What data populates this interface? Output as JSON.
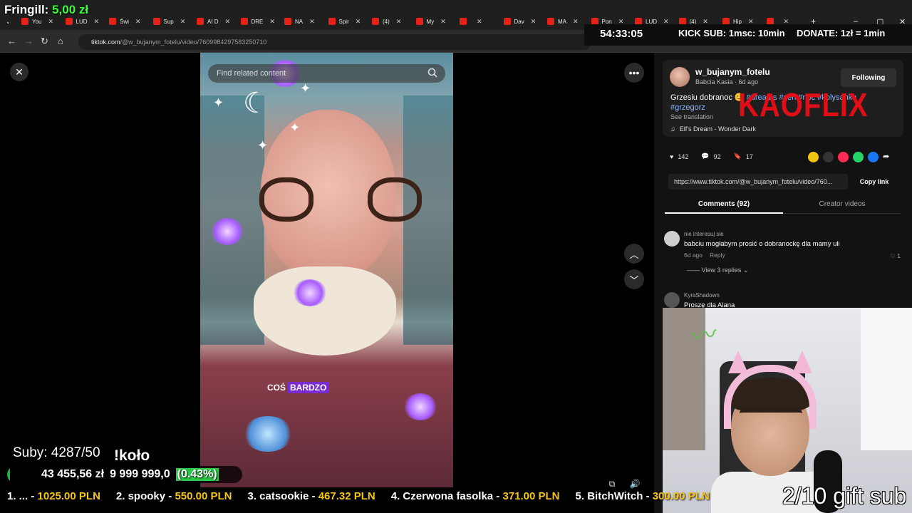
{
  "overlay": {
    "fringill_label": "Fringill:",
    "fringill_amount": "5,00 zł",
    "timer": "54:33:05",
    "kick_sub": "KICK SUB: 1msc: 10min",
    "donate": "DONATE: 1zł = 1min",
    "subs": "Suby: 4287/50",
    "kolo": "!koło",
    "goal_current": "43 455,56 zł",
    "goal_target": "9 999 999,0",
    "goal_percent": "(0.43%)",
    "goal_fraction": 0.0043,
    "gift_sub": "2/10 gift sub",
    "ticker": [
      {
        "name": "1. ... - ",
        "amount": "1025.00 PLN"
      },
      {
        "name": "2. spooky - ",
        "amount": "550.00 PLN"
      },
      {
        "name": "3. catsookie - ",
        "amount": "467.32 PLN"
      },
      {
        "name": "4. Czerwona fasolka - ",
        "amount": "371.00 PLN"
      },
      {
        "name": "5. BitchWitch - ",
        "amount": "300.00 PLN"
      }
    ],
    "colors": {
      "green": "#39ff3a",
      "gold": "#f5c517",
      "goal_green": "#1fb13a"
    }
  },
  "browser": {
    "tabs": [
      "You",
      "LUD",
      "Świ",
      "Sup",
      "AI D",
      "DRE",
      "NA",
      "Spir",
      "(4)",
      "My",
      "",
      "Dav",
      "MA",
      "Pon",
      "LUD",
      "(4)",
      "Hip",
      ""
    ],
    "url_domain": "tiktok.com",
    "url_path": "/@w_bujanym_fotelu/video/7609984297583250710"
  },
  "video": {
    "search_placeholder": "Find related content",
    "caption_word1": "COŚ",
    "caption_word2": "BARDZO"
  },
  "panel": {
    "username": "w_bujanym_fotelu",
    "display_name": "Babcia Kasia",
    "age": "6d ago",
    "follow_label": "Following",
    "description_text": "Grzesiu dobranoc",
    "description_tags": "#dreams #sen #noc #kolysanka",
    "description_tag2": "#grzegorz",
    "see_translation": "See translation",
    "music": "Elf's Dream - Wonder Dark",
    "watermark": "KAOFLIX",
    "likes": "142",
    "comments": "92",
    "saves": "17",
    "link": "https://www.tiktok.com/@w_bujanym_fotelu/video/760...",
    "copy_label": "Copy link",
    "tab_comments": "Comments (92)",
    "tab_creator": "Creator videos",
    "comment1": {
      "user": "nie interesuj sie",
      "text": "babciu mogłabym prosić o dobranockę dla mamy uli",
      "age": "6d ago",
      "reply": "Reply",
      "likes": "1",
      "replies": "View 3 replies"
    },
    "comment2": {
      "user": "KyraShadown",
      "text": "Proszę dla Alana"
    }
  }
}
